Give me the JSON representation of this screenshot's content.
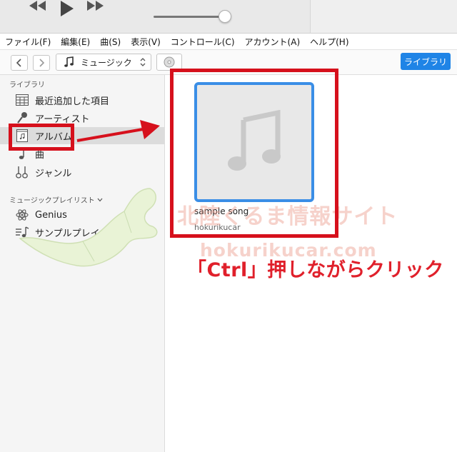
{
  "menu": [
    "ファイル(F)",
    "編集(E)",
    "曲(S)",
    "表示(V)",
    "コントロール(C)",
    "アカウント(A)",
    "ヘルプ(H)"
  ],
  "toolbar": {
    "media_type": "ミュージック",
    "library_button": "ライブラリ"
  },
  "sidebar": {
    "library_header": "ライブラリ",
    "items": [
      {
        "label": "最近追加した項目",
        "icon": "grid-icon"
      },
      {
        "label": "アーティスト",
        "icon": "microphone-icon"
      },
      {
        "label": "アルバム",
        "icon": "album-icon",
        "selected": true
      },
      {
        "label": "曲",
        "icon": "note-icon"
      },
      {
        "label": "ジャンル",
        "icon": "guitar-icon"
      }
    ],
    "playlists_header": "ミュージックプレイリスト",
    "playlists": [
      {
        "label": "Genius",
        "icon": "atom-icon"
      },
      {
        "label": "サンプルプレイリスト",
        "icon": "playlist-icon"
      }
    ]
  },
  "album": {
    "title": "sample song",
    "artist": "hokurikucar"
  },
  "annotation": {
    "instruction": "「Ctrl」押しながらクリック",
    "color": "#e0202b"
  },
  "watermark": {
    "line1": "北陸くるま情報サイト",
    "line2": "hokurikucar.com"
  }
}
